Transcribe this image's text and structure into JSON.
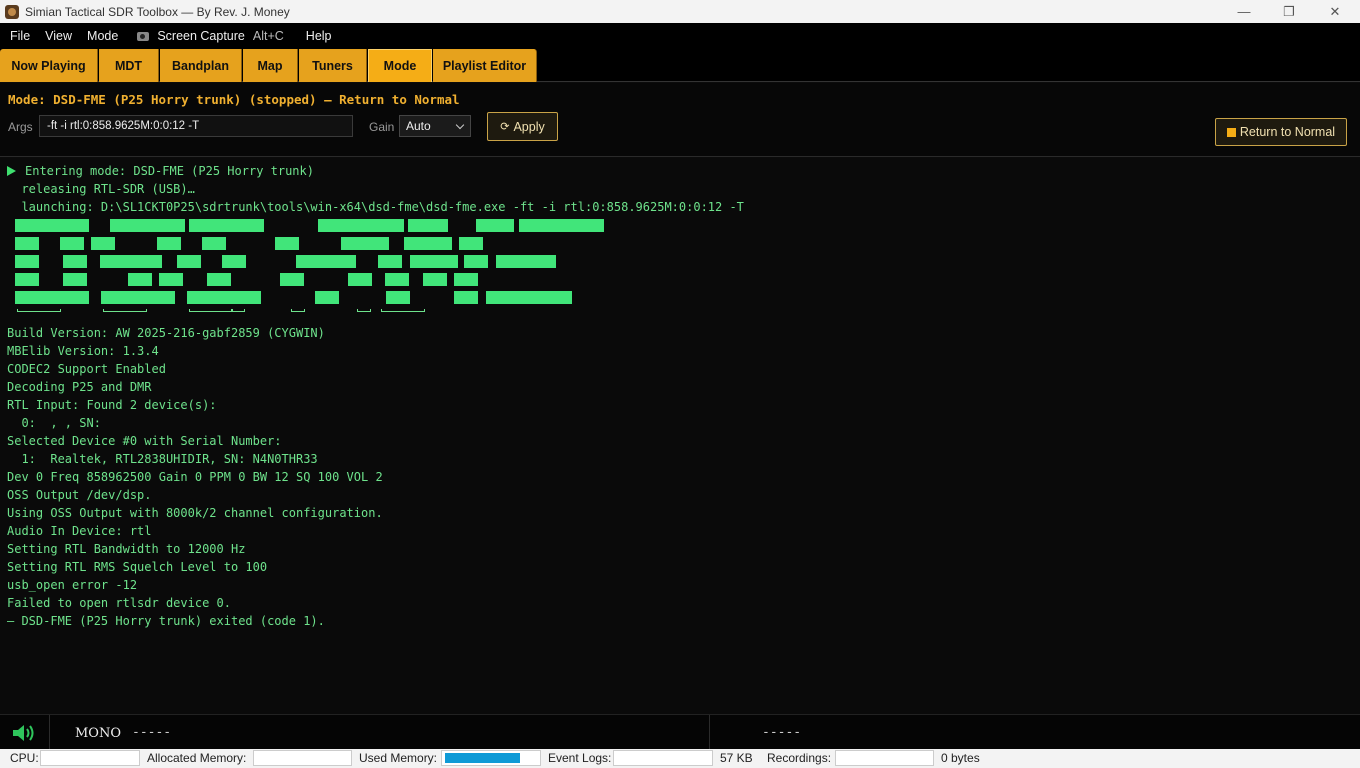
{
  "window": {
    "title": "Simian Tactical SDR Toolbox — By Rev. J. Money",
    "minimize_glyph": "—",
    "maximize_glyph": "❐",
    "close_glyph": "✕"
  },
  "menu": {
    "file": "File",
    "view": "View",
    "mode": "Mode",
    "capture": "Screen Capture",
    "capture_shortcut": "Alt+C",
    "help": "Help"
  },
  "tabs": [
    {
      "label": "Now Playing"
    },
    {
      "label": "MDT"
    },
    {
      "label": "Bandplan"
    },
    {
      "label": "Map"
    },
    {
      "label": "Tuners"
    },
    {
      "label": "Mode",
      "active": true
    },
    {
      "label": "Playlist Editor"
    }
  ],
  "mode_panel": {
    "title": "Mode: DSD-FME (P25 Horry trunk) (stopped) — Return to Normal",
    "args_label": "Args",
    "args_value": "-ft -i rtl:0:858.9625M:0:0:12 -T",
    "gain_label": "Gain",
    "gain_value": "Auto",
    "apply_icon": "⟳",
    "apply_label": "Apply",
    "return_label": "Return to Normal"
  },
  "console": {
    "header_lines": [
      "Entering mode: DSD-FME (P25 Horry trunk)",
      "  releasing RTL-SDR (USB)…",
      "  launching: D:\\SL1CKT0P25\\sdrtrunk\\tools\\win-x64\\dsd-fme\\dsd-fme.exe -ft -i rtl:0:858.9625M:0:0:12 -T"
    ],
    "lines": [
      "Build Version: AW 2025-216-gabf2859 (CYGWIN)",
      "MBElib Version: 1.3.4",
      "CODEC2 Support Enabled",
      "Decoding P25 and DMR",
      "RTL Input: Found 2 device(s):",
      "  0:  , , SN:",
      "Selected Device #0 with Serial Number:",
      "  1:  Realtek, RTL2838UHIDIR, SN: N4N0THR33",
      "Dev 0 Freq 858962500 Gain 0 PPM 0 BW 12 SQ 100 VOL 2",
      "OSS Output /dev/dsp.",
      "Using OSS Output with 8000k/2 channel configuration.",
      "Audio In Device: rtl",
      "Setting RTL Bandwidth to 12000 Hz",
      "Setting RTL RMS Squelch Level to 100",
      "usb_open error -12",
      "Failed to open rtlsdr device 0.",
      "— DSD-FME (P25 Horry trunk) exited (code 1)."
    ]
  },
  "audio_bar": {
    "channel_mode": "MONO",
    "left_readout": "-----",
    "right_readout": "-----"
  },
  "status_bar": {
    "cpu_label": "CPU:",
    "alloc_label": "Allocated Memory:",
    "used_label": "Used Memory:",
    "used_fraction": 0.82,
    "events_label": "Event Logs:",
    "events_size": "57 KB",
    "rec_label": "Recordings:",
    "rec_size": "0 bytes"
  },
  "colors": {
    "accent_tab": "#e6a21d",
    "console_text": "#6ee38c",
    "mode_title": "#f0b030",
    "memory_fill": "#0f9ad6"
  }
}
